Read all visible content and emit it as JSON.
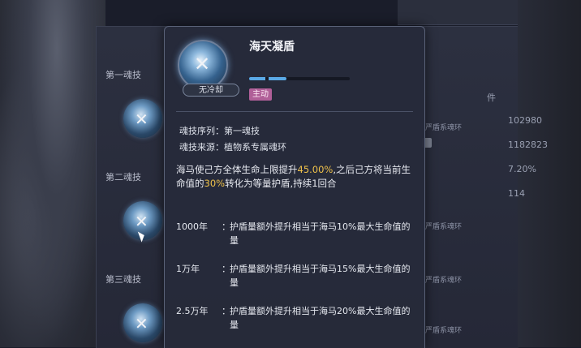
{
  "background": {
    "ring_slots": [
      "第一魂技",
      "第二魂技",
      "第三魂技"
    ],
    "ring_labels": [
      "严盾系魂环",
      "严盾系魂环",
      "严盾系魂环",
      "严盾系魂环"
    ],
    "stats": [
      "102980",
      "1182823",
      "7.20%",
      "114"
    ],
    "header_fragment": "件"
  },
  "tooltip": {
    "skill_name": "海天凝盾",
    "cooldown": "无冷却",
    "level_progress": 0.37,
    "type_tag": "主动",
    "sequence_label": "魂技序列：",
    "sequence_value": "第一魂技",
    "source_label": "魂技来源：",
    "source_value": "植物系专属魂环",
    "description": {
      "part1": "海马使己方全体生命上限提升",
      "pct1": "45.00%",
      "part2": ",之后己方将当前生命值的",
      "pct2": "30%",
      "part3": "转化为等量护盾,持续1回合"
    },
    "tiers": [
      {
        "year": "1000年",
        "colon": "：",
        "text": "护盾量额外提升相当于海马10%最大生命值的量"
      },
      {
        "year": "1万年",
        "colon": "：",
        "text": "护盾量额外提升相当于海马15%最大生命值的量"
      },
      {
        "year": "2.5万年",
        "colon": "：",
        "text": "护盾量额外提升相当于海马20%最大生命值的量"
      }
    ]
  },
  "colors": {
    "highlight": "#f0c24a",
    "type_tag": "#b05f98",
    "level_fill": "#5aa9e6"
  }
}
